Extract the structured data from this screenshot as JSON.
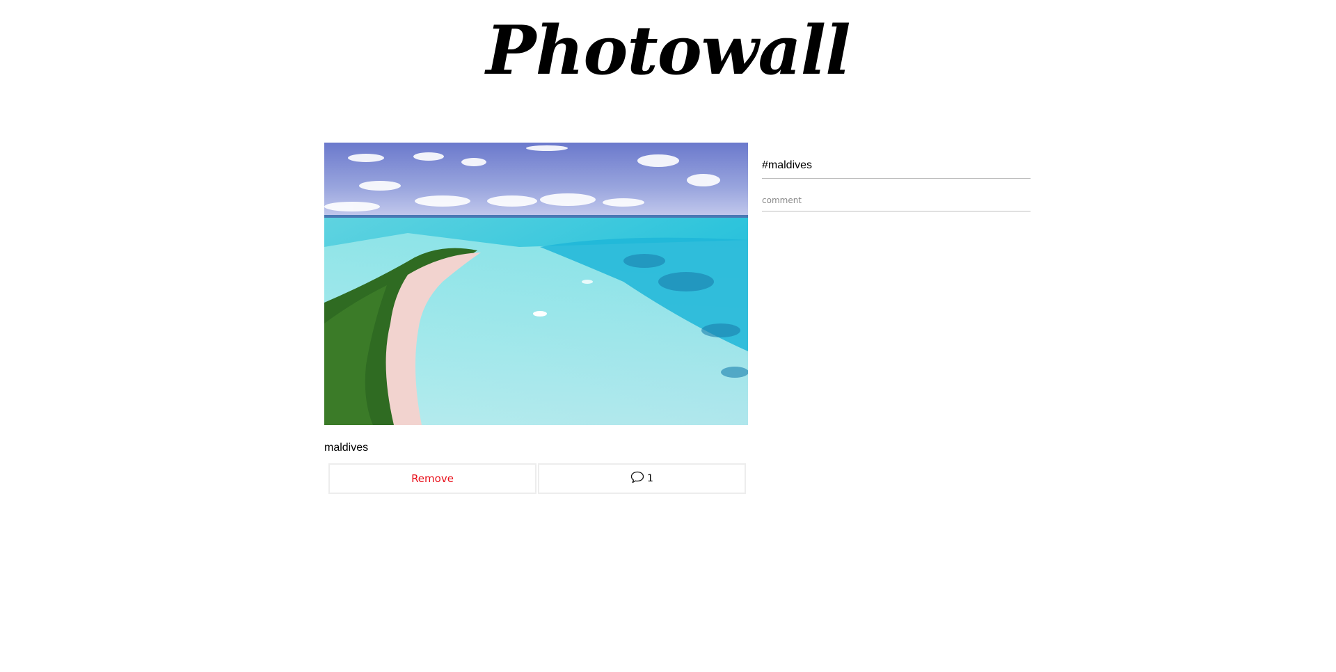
{
  "app": {
    "title": "Photowall"
  },
  "post": {
    "description": "maldives",
    "photo_alt": "maldives"
  },
  "actions": {
    "remove_label": "Remove",
    "comment_count": "1",
    "comment_icon": "speech-bubble-icon"
  },
  "comments_panel": {
    "hashtag": "#maldives",
    "input_placeholder": "comment"
  },
  "colors": {
    "remove": "#e8101b",
    "divider": "#bdbdbd",
    "button_border": "#ededed"
  }
}
